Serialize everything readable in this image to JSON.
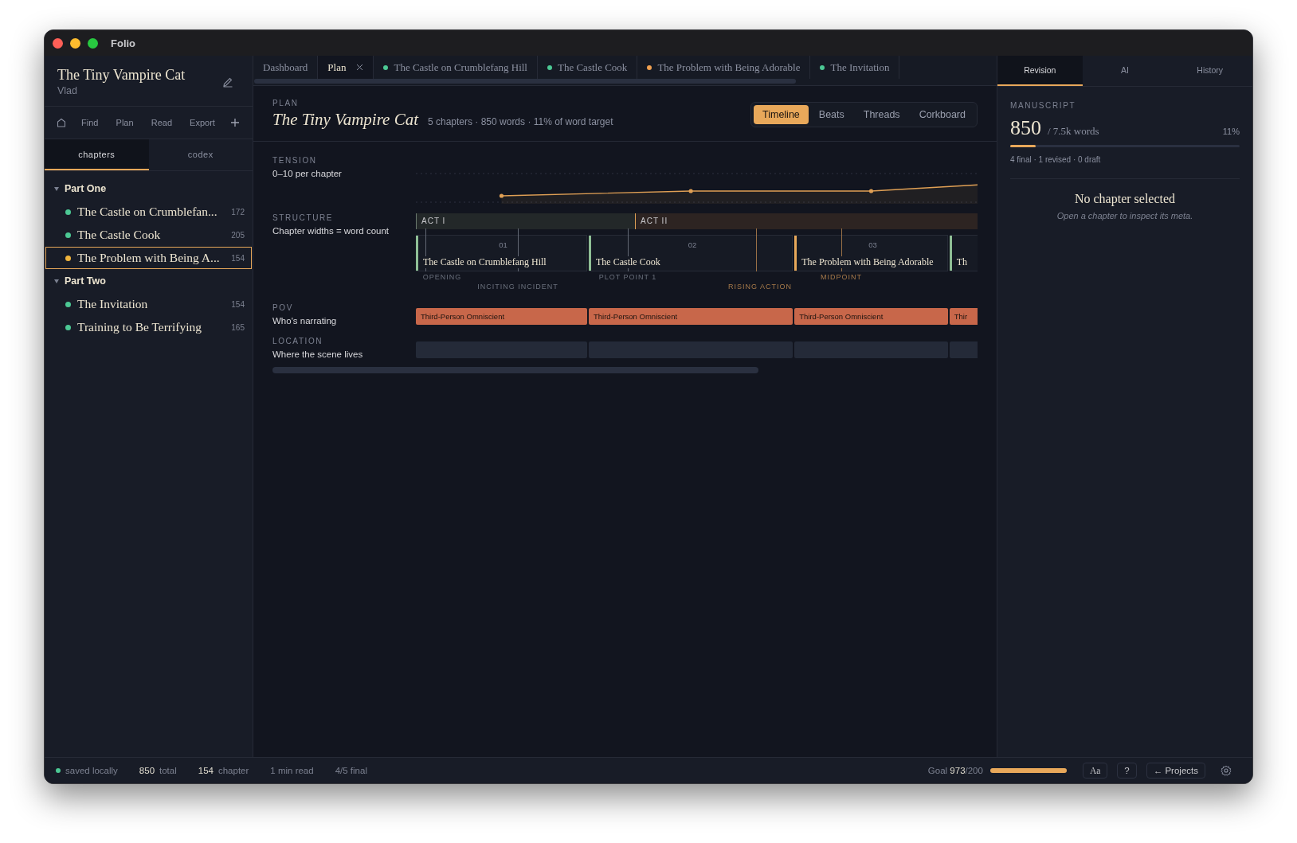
{
  "window": {
    "title": "Folio"
  },
  "sidebar": {
    "title": "The Tiny Vampire Cat",
    "author": "Vlad",
    "toolbar": [
      "Find",
      "Plan",
      "Read",
      "Export"
    ],
    "tabs": [
      {
        "label": "chapters",
        "selected": true
      },
      {
        "label": "codex",
        "selected": false
      }
    ],
    "parts": [
      {
        "title": "Part One",
        "expanded": true,
        "children": [
          {
            "title": "The Castle on Crumblefan...",
            "count": "172",
            "color": "#4cc894",
            "selected": false
          },
          {
            "title": "The Castle Cook",
            "count": "205",
            "color": "#4cc894",
            "selected": false
          },
          {
            "title": "The Problem with Being A...",
            "count": "154",
            "color": "#f0b43c",
            "selected": true
          }
        ]
      },
      {
        "title": "Part Two",
        "expanded": true,
        "children": [
          {
            "title": "The Invitation",
            "count": "154",
            "color": "#4cc894",
            "selected": false
          },
          {
            "title": "Training to Be Terrifying",
            "count": "165",
            "color": "#4cc894",
            "selected": false
          }
        ]
      }
    ]
  },
  "editor_tabs": [
    {
      "label": "Dashboard",
      "selected": false,
      "closable": false
    },
    {
      "label": "Plan",
      "selected": true,
      "closable": true
    },
    {
      "label": "The Castle on Crumblefang Hill",
      "selected": false,
      "closable": false,
      "color": "#4cc894"
    },
    {
      "label": "The Castle Cook",
      "selected": false,
      "closable": false,
      "color": "#4cc894"
    },
    {
      "label": "The Problem with Being Adorable",
      "selected": false,
      "closable": false,
      "color": "#f0a050"
    },
    {
      "label": "The Invitation",
      "selected": false,
      "closable": false,
      "color": "#4cc894"
    }
  ],
  "plan": {
    "eyebrow": "PLAN",
    "title": "The Tiny Vampire Cat",
    "summary": "5 chapters · 850 words · 11% of word target",
    "views": [
      {
        "label": "Timeline",
        "selected": true
      },
      {
        "label": "Beats",
        "selected": false
      },
      {
        "label": "Threads",
        "selected": false
      },
      {
        "label": "Corkboard",
        "selected": false
      }
    ]
  },
  "tension": {
    "label": "TENSION",
    "sub": "0–10 per chapter"
  },
  "structure": {
    "label": "STRUCTURE",
    "sub": "Chapter widths = word count",
    "acts": [
      {
        "label": "ACT I",
        "color": "#6a7a6e"
      },
      {
        "label": "ACT II",
        "color": "#e0a055"
      }
    ],
    "chapters": [
      {
        "number": "01",
        "title": "The Castle on Crumblefang Hill",
        "color": "#8fbf95"
      },
      {
        "number": "02",
        "title": "The Castle Cook",
        "color": "#8fbf95"
      },
      {
        "number": "03",
        "title": "The Problem with Being Adorable",
        "color": "#e8a95a"
      },
      {
        "title": "Th",
        "color": "#8fbf95"
      }
    ],
    "beats": [
      {
        "label": "OPENING",
        "kind": "neutral"
      },
      {
        "label": "INCITING INCIDENT",
        "kind": "neutral"
      },
      {
        "label": "PLOT POINT 1",
        "kind": "neutral"
      },
      {
        "label": "RISING ACTION",
        "kind": "accent"
      },
      {
        "label": "MIDPOINT",
        "kind": "accent"
      }
    ]
  },
  "pov": {
    "label": "POV",
    "sub": "Who's narrating",
    "bars": [
      "Third-Person Omniscient",
      "Third-Person Omniscient",
      "Third-Person Omniscient",
      "Thir"
    ]
  },
  "location": {
    "label": "LOCATION",
    "sub": "Where the scene lives"
  },
  "inspector": {
    "tabs": [
      {
        "label": "Revision",
        "selected": true
      },
      {
        "label": "AI",
        "selected": false
      },
      {
        "label": "History",
        "selected": false
      }
    ],
    "eyebrow": "MANUSCRIPT",
    "count": "850",
    "target": "/ 7.5k words",
    "percent": "11%",
    "level": 0.11,
    "breakdown": "4 final · 1 revised · 0 draft",
    "empty_title": "No chapter selected",
    "empty_hint": "Open a chapter to inspect its meta."
  },
  "status_bar": {
    "items": [
      {
        "kind": "saved",
        "label": "saved locally"
      },
      {
        "kind": "stat",
        "value": "850",
        "label": "total"
      },
      {
        "kind": "stat",
        "value": "154",
        "label": "chapter"
      },
      {
        "kind": "plain",
        "label": "1 min read"
      },
      {
        "kind": "plain",
        "label": "4/5 final"
      }
    ],
    "goal": {
      "label": "Goal",
      "value": "973",
      "target": "/200",
      "level": 1
    },
    "buttons": [
      "Aa",
      "?",
      "← Projects"
    ]
  }
}
